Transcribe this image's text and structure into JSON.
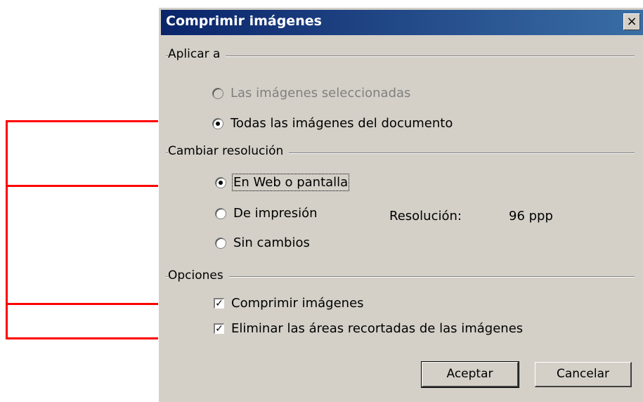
{
  "window": {
    "title": "Comprimir imágenes",
    "close_label": "×"
  },
  "apply_to": {
    "label": "Aplicar a",
    "options": [
      {
        "label": "Las imágenes seleccionadas",
        "selected": false,
        "disabled": true
      },
      {
        "label": "Todas las imágenes del documento",
        "selected": true,
        "disabled": false
      }
    ]
  },
  "resolution": {
    "label": "Cambiar resolución",
    "options": [
      {
        "label": "En Web o pantalla",
        "selected": true
      },
      {
        "label": "De impresión",
        "selected": false
      },
      {
        "label": "Sin cambios",
        "selected": false
      }
    ],
    "value_label": "Resolución:",
    "value": "96 ppp"
  },
  "options": {
    "label": "Opciones",
    "checks": [
      {
        "label": "Comprimir imágenes",
        "checked": true
      },
      {
        "label": "Eliminar las áreas recortadas de las imágenes",
        "checked": true
      }
    ]
  },
  "buttons": {
    "ok": "Aceptar",
    "cancel": "Cancelar"
  },
  "annotation_color": "#ff0000"
}
